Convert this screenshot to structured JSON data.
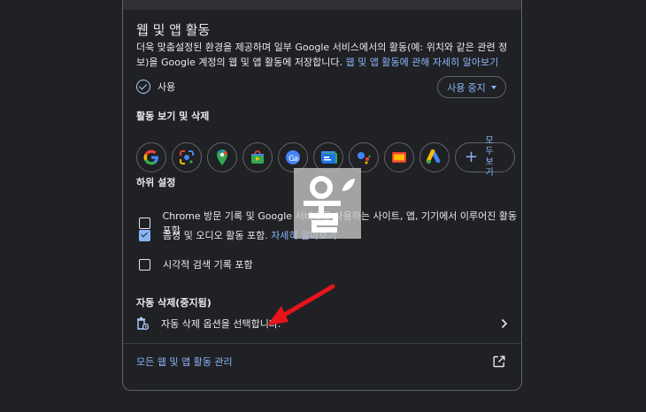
{
  "section": {
    "title": "웹 및 앱 활동",
    "description": "더욱 맞춤설정된 환경을 제공하며 일부 Google 서비스에서의 활동(예: 위치와 같은 관련 정보)을 Google 계정의 웹 및 앱 활동에 저장합니다.",
    "learn_more": "웹 및 앱 활동에 관해 자세히 알아보기",
    "status_label": "사용",
    "stop_button": "사용 중지"
  },
  "activity": {
    "heading": "활동 보기 및 삭제",
    "apps": [
      {
        "name": "google-icon",
        "color": "#4285f4"
      },
      {
        "name": "lens-icon",
        "color": "#4285f4"
      },
      {
        "name": "maps-icon",
        "color": "#34a853"
      },
      {
        "name": "play-store-icon",
        "color": "#34a853"
      },
      {
        "name": "translate-icon",
        "color": "#4285f4"
      },
      {
        "name": "news-icon",
        "color": "#4285f4"
      },
      {
        "name": "assistant-icon",
        "color": "#ea4335"
      },
      {
        "name": "ad-manager-icon",
        "color": "#fbbc04"
      },
      {
        "name": "google-ads-icon",
        "color": "#4285f4"
      }
    ],
    "view_all": "모두 보기"
  },
  "sub_settings": {
    "heading": "하위 설정",
    "items": [
      {
        "label": "Chrome 방문 기록 및 Google 서비스를 사용하는 사이트, 앱, 기기에서 이루어진 활동 포함",
        "link": "",
        "checked": false
      },
      {
        "label": "음성 및 오디오 활동 포함.",
        "link": "자세히 알아보기",
        "checked": true
      },
      {
        "label": "시각적 검색 기록 포함",
        "link": "",
        "checked": false
      }
    ]
  },
  "auto_delete": {
    "heading": "자동 삭제(중지됨)",
    "option": "자동 삭제 옵션을 선택합니다."
  },
  "footer": {
    "manage_link": "모든 웹 및 앱 활동 관리"
  },
  "colors": {
    "background": "#202124",
    "accent": "#8ab4f8",
    "arrow": "#e8141b"
  }
}
